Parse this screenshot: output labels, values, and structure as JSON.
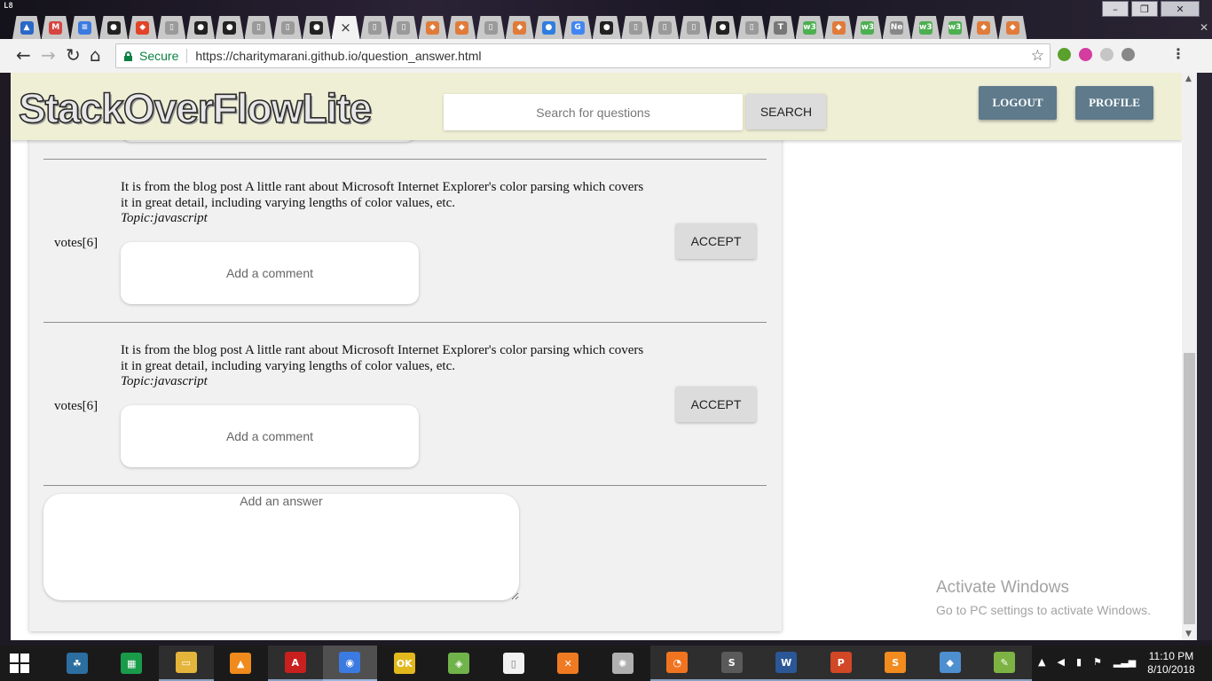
{
  "browser": {
    "profile_badge": "L8",
    "tabs": [
      {
        "icon": "drive-icon",
        "glyph": "▲",
        "color": "#2a68c7"
      },
      {
        "icon": "gmail-icon",
        "glyph": "M",
        "color": "#d64541"
      },
      {
        "icon": "docs-icon",
        "glyph": "≡",
        "color": "#3b7ae0"
      },
      {
        "icon": "github-icon",
        "glyph": "●",
        "color": "#222222"
      },
      {
        "icon": "gitlab-icon",
        "glyph": "◆",
        "color": "#e24329"
      },
      {
        "icon": "page-icon",
        "glyph": "▯",
        "color": "#9a9a9a"
      },
      {
        "icon": "github-icon",
        "glyph": "●",
        "color": "#222222"
      },
      {
        "icon": "github-icon",
        "glyph": "●",
        "color": "#222222"
      },
      {
        "icon": "page-icon",
        "glyph": "▯",
        "color": "#9a9a9a"
      },
      {
        "icon": "page-icon",
        "glyph": "▯",
        "color": "#9a9a9a"
      },
      {
        "icon": "github-icon",
        "glyph": "●",
        "color": "#222222"
      },
      {
        "icon": "close-icon",
        "glyph": "×",
        "color": "active"
      },
      {
        "icon": "page-icon",
        "glyph": "▯",
        "color": "#9a9a9a"
      },
      {
        "icon": "page-icon",
        "glyph": "▯",
        "color": "#9a9a9a"
      },
      {
        "icon": "git-icon",
        "glyph": "◆",
        "color": "#e07b39"
      },
      {
        "icon": "git-icon",
        "glyph": "◆",
        "color": "#e07b39"
      },
      {
        "icon": "page-icon",
        "glyph": "▯",
        "color": "#9a9a9a"
      },
      {
        "icon": "git-icon",
        "glyph": "◆",
        "color": "#e07b39"
      },
      {
        "icon": "chrome-store-icon",
        "glyph": "●",
        "color": "#2f7de1"
      },
      {
        "icon": "google-icon",
        "glyph": "G",
        "color": "#4285f4"
      },
      {
        "icon": "github-icon",
        "glyph": "●",
        "color": "#222222"
      },
      {
        "icon": "page-icon",
        "glyph": "▯",
        "color": "#9a9a9a"
      },
      {
        "icon": "page-icon",
        "glyph": "▯",
        "color": "#9a9a9a"
      },
      {
        "icon": "page-icon",
        "glyph": "▯",
        "color": "#9a9a9a"
      },
      {
        "icon": "github-icon",
        "glyph": "●",
        "color": "#222222"
      },
      {
        "icon": "page-icon",
        "glyph": "▯",
        "color": "#9a9a9a"
      },
      {
        "icon": "typography-icon",
        "glyph": "T",
        "color": "#777777"
      },
      {
        "icon": "w3schools-icon",
        "glyph": "w3",
        "color": "#4caf50"
      },
      {
        "icon": "git-icon",
        "glyph": "◆",
        "color": "#e07b39"
      },
      {
        "icon": "w3schools-icon",
        "glyph": "w3",
        "color": "#4caf50"
      },
      {
        "icon": "new-tab-icon",
        "glyph": "Ne",
        "color": "#888888"
      },
      {
        "icon": "w3schools-icon",
        "glyph": "w3",
        "color": "#4caf50"
      },
      {
        "icon": "w3schools-icon",
        "glyph": "w3",
        "color": "#4caf50"
      },
      {
        "icon": "git-icon",
        "glyph": "◆",
        "color": "#e07b39"
      },
      {
        "icon": "git-icon",
        "glyph": "◆",
        "color": "#e07b39"
      }
    ],
    "nav": {
      "back": "←",
      "forward": "→",
      "reload": "↻",
      "home": "⌂"
    },
    "omnibox": {
      "secure_label": "Secure",
      "url": "https://charitymarani.github.io/question_answer.html"
    },
    "window_controls": {
      "minimize": "–",
      "maximize": "❐",
      "close": "✕"
    },
    "extensions": [
      "#5aa02c",
      "#d43ca0",
      "#c5c5c5",
      "#888888"
    ]
  },
  "site": {
    "logo": "StackOverFlowLite",
    "search": {
      "placeholder": "Search for questions",
      "button": "SEARCH"
    },
    "logout_label": "LOGOUT",
    "profile_label": "PROFILE"
  },
  "answers": [
    {
      "votes": "votes[6]",
      "text": "It is from the blog post A little rant about Microsoft Internet Explorer's color parsing which covers it in great detail, including varying lengths of color values, etc.",
      "topic": "Topic:javascript",
      "comment_placeholder": "Add a comment",
      "accept_label": "ACCEPT"
    },
    {
      "votes": "votes[6]",
      "text": "It is from the blog post A little rant about Microsoft Internet Explorer's color parsing which covers it in great detail, including varying lengths of color values, etc.",
      "topic": "Topic:javascript",
      "comment_placeholder": "Add a comment",
      "accept_label": "ACCEPT"
    }
  ],
  "answer_input": {
    "placeholder": "Add an answer"
  },
  "watermark": {
    "title": "Activate Windows",
    "subtitle": "Go to PC settings to activate Windows."
  },
  "taskbar": {
    "apps": [
      {
        "name": "ccleaner-icon",
        "glyph": "☘",
        "color": "#2c6ea0",
        "state": ""
      },
      {
        "name": "store-icon",
        "glyph": "▦",
        "color": "#1a9b4a",
        "state": ""
      },
      {
        "name": "file-explorer-icon",
        "glyph": "▭",
        "color": "#e5b53b",
        "state": "open"
      },
      {
        "name": "vlc-icon",
        "glyph": "▲",
        "color": "#f08a1c",
        "state": ""
      },
      {
        "name": "acrobat-icon",
        "glyph": "A",
        "color": "#c8201e",
        "state": "open"
      },
      {
        "name": "chrome-icon",
        "glyph": "◉",
        "color": "#3b7ae0",
        "state": "active"
      },
      {
        "name": "sticker-icon",
        "glyph": "OK",
        "color": "#e3b81c",
        "state": ""
      },
      {
        "name": "android-studio-icon",
        "glyph": "◈",
        "color": "#6fb34a",
        "state": ""
      },
      {
        "name": "document-icon",
        "glyph": "▯",
        "color": "#f2f2f2",
        "state": ""
      },
      {
        "name": "xampp-icon",
        "glyph": "✕",
        "color": "#f07a21",
        "state": ""
      },
      {
        "name": "spider-icon",
        "glyph": "✺",
        "color": "#b0b0b0",
        "state": ""
      },
      {
        "name": "firefox-icon",
        "glyph": "◔",
        "color": "#f07420",
        "state": "open"
      },
      {
        "name": "slack-icon",
        "glyph": "S",
        "color": "#5a5a5a",
        "state": "open"
      },
      {
        "name": "word-icon",
        "glyph": "W",
        "color": "#2b5797",
        "state": "open"
      },
      {
        "name": "powerpoint-icon",
        "glyph": "P",
        "color": "#d24726",
        "state": "open"
      },
      {
        "name": "sublime-icon",
        "glyph": "S",
        "color": "#f28c1f",
        "state": "open"
      },
      {
        "name": "git-gui-icon",
        "glyph": "◆",
        "color": "#4e8fd0",
        "state": "open"
      },
      {
        "name": "notepad-plus-icon",
        "glyph": "✎",
        "color": "#7cb342",
        "state": "open"
      }
    ],
    "clock": {
      "time": "11:10 PM",
      "date": "8/10/2018"
    }
  }
}
